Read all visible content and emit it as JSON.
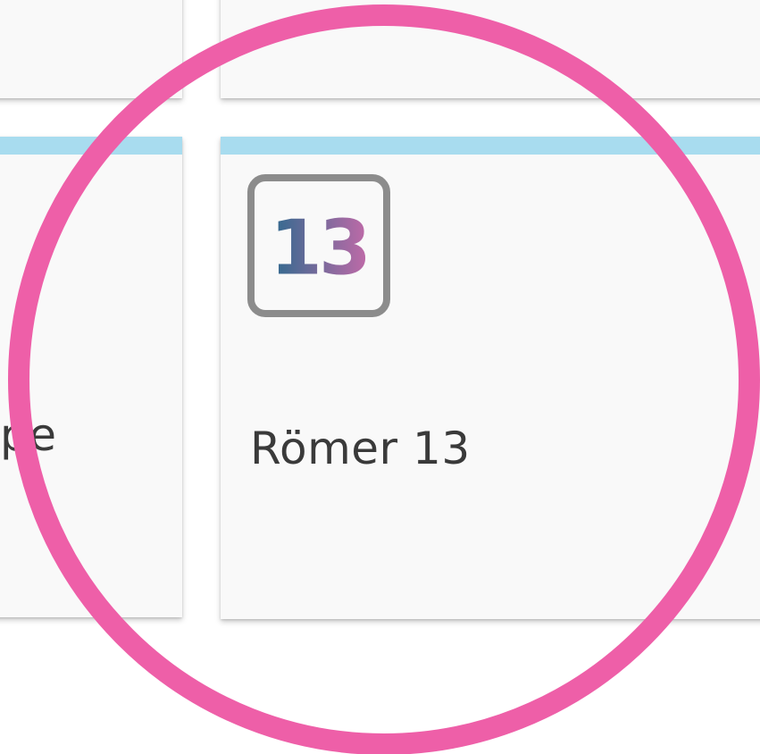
{
  "cards": {
    "top_left": {},
    "top_right": {},
    "bottom_left": {
      "label": "pe"
    },
    "bottom_right": {
      "icon_number": "13",
      "label": "Römer 13"
    }
  },
  "colors": {
    "accent_bar": "#a8dcef",
    "card_background": "#f9f9f9",
    "icon_border": "#8c8c8c",
    "icon_gradient_start": "#2d6a8e",
    "icon_gradient_end": "#c06aa8",
    "highlight_circle": "#ee5fa8"
  },
  "icons": {
    "card_icon": "number-13-icon"
  }
}
